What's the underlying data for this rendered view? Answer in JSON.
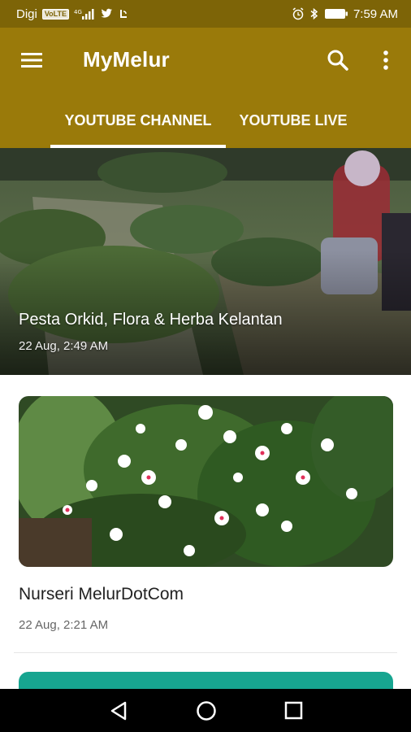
{
  "status_bar": {
    "carrier": "Digi",
    "volte": "VoLTE",
    "network": "4G",
    "time": "7:59 AM"
  },
  "app_bar": {
    "title": "MyMelur",
    "icons": [
      "menu-icon",
      "search-icon",
      "more-vert-icon"
    ],
    "color": "#9a7a0a"
  },
  "tabs": [
    {
      "label": "YOUTUBE CHANNEL",
      "selected": true
    },
    {
      "label": "YOUTUBE LIVE",
      "selected": false
    }
  ],
  "featured": {
    "title": "Pesta Orkid, Flora & Herba Kelantan",
    "date": "22 Aug, 2:49 AM"
  },
  "videos": [
    {
      "title": "Nurseri MelurDotCom",
      "date": "22 Aug, 2:21 AM"
    }
  ],
  "nav_bar": {
    "icons": [
      "back-icon",
      "home-icon",
      "recents-icon"
    ]
  }
}
